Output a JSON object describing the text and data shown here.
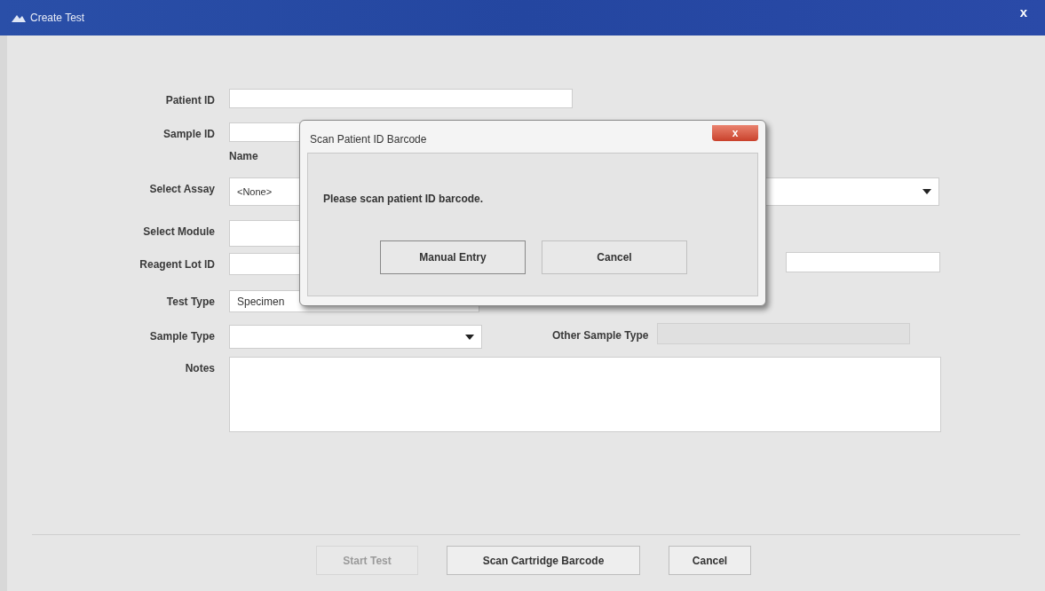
{
  "window": {
    "title": "Create Test",
    "close": "x"
  },
  "form": {
    "rows": [
      {
        "kind": "text",
        "label": "Patient ID"
      },
      {
        "kind": "text",
        "label": "Sample ID"
      },
      {
        "kind": "header",
        "label": "Name"
      },
      {
        "kind": "dropdown",
        "label": "Select Assay",
        "value": "<None>"
      },
      {
        "kind": "text",
        "label": "Select Module"
      },
      {
        "kind": "text",
        "label": "Reagent Lot ID",
        "side_field": true
      },
      {
        "kind": "text",
        "label": "Test Type",
        "value": "Specimen"
      },
      {
        "kind": "dropdown",
        "label": "Sample Type",
        "side_label": "Other Sample Type",
        "side_disabled": true
      },
      {
        "kind": "textarea",
        "label": "Notes"
      }
    ]
  },
  "buttons": [
    {
      "label": "Start Test",
      "disabled": true
    },
    {
      "label": "Scan Cartridge Barcode",
      "disabled": false
    },
    {
      "label": "Cancel",
      "disabled": false
    }
  ],
  "dialog": {
    "title": "Scan Patient ID Barcode",
    "close": "x",
    "message": "Please scan patient ID barcode.",
    "buttons": [
      "Manual Entry",
      "Cancel"
    ]
  }
}
